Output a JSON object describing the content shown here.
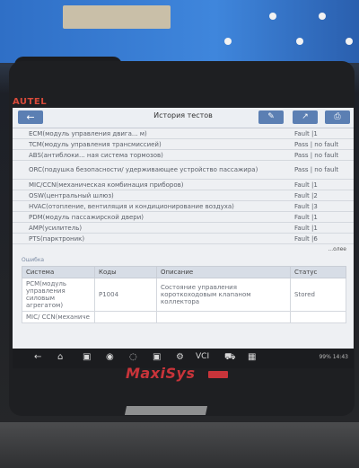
{
  "device": {
    "brand": "AUTEL",
    "model": "MaxiSys"
  },
  "topbar": {
    "title": "История тестов",
    "back_icon": "back-arrow-icon",
    "tools": [
      "edit-icon",
      "share-icon",
      "print-icon"
    ]
  },
  "systems": [
    {
      "name": "ECM(модуль управления двига... м)",
      "status": "Fault |1"
    },
    {
      "name": "TCM(модуль управления трансмиссией)",
      "status": "Pass | no fault"
    },
    {
      "name": "ABS(антиблоки... ная система тормозов)",
      "status": "Pass | no fault"
    },
    {
      "name": "ORC(подушка безопасности/ удерживающее устройство пассажира)",
      "status": "Pass | no fault"
    },
    {
      "name": "MIC/CCN(механическая комбинация приборов)",
      "status": "Fault |1"
    },
    {
      "name": "OSW(центральный шлюз)",
      "status": "Fault |2"
    },
    {
      "name": "HVAC(отопление, вентиляция и кондиционирование воздуха)",
      "status": "Fault |3"
    },
    {
      "name": "PDM(модуль пассажирской двери)",
      "status": "Fault |1"
    },
    {
      "name": "AMP(усилитель)",
      "status": "Fault |1"
    },
    {
      "name": "PTS(парктроник)",
      "status": "Fault |6"
    }
  ],
  "more_label": "...олее",
  "errors_section": {
    "label": "Ошибка",
    "headers": [
      "Система",
      "Коды",
      "Описание",
      "Статус"
    ],
    "rows": [
      {
        "system": "PCM(модуль управления силовым агрегатом)",
        "code": "P1004",
        "description": "Состояние управления короткоходовым клапаном коллектора",
        "status": "Stored"
      },
      {
        "system": "MIC/ CCN(механиче",
        "code": "",
        "description": "",
        "status": ""
      }
    ]
  },
  "navbar": {
    "icons": [
      "back-icon",
      "home-icon",
      "recent-apps-icon",
      "chrome-icon",
      "camera-icon",
      "screenshot-icon",
      "settings-icon",
      "garage-icon",
      "vci-icon",
      "car-icon",
      "shop-icon"
    ],
    "vci_label": "VCI",
    "status": "99% 14:43"
  },
  "colors": {
    "accent": "#5b7fb3",
    "brand_red": "#c9343a"
  }
}
